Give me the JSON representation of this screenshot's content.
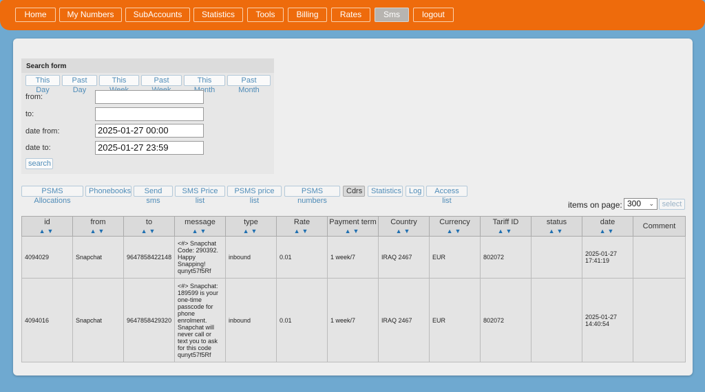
{
  "nav": {
    "items": [
      "Home",
      "My Numbers",
      "SubAccounts",
      "Statistics",
      "Tools",
      "Billing",
      "Rates",
      "Sms",
      "logout"
    ],
    "active": "Sms"
  },
  "search_form": {
    "title": "Search form",
    "ranges": [
      "This Day",
      "Past Day",
      "This Week",
      "Past Week",
      "This Month",
      "Past Month"
    ],
    "from_label": "from:",
    "from_value": "",
    "to_label": "to:",
    "to_value": "",
    "date_from_label": "date from:",
    "date_from_value": "2025-01-27 00:00",
    "date_to_label": "date to:",
    "date_to_value": "2025-01-27 23:59",
    "search_label": "search"
  },
  "subnav": {
    "items": [
      "PSMS Allocations",
      "Phonebooks",
      "Send sms",
      "SMS Price list",
      "PSMS price list",
      "PSMS numbers",
      "Cdrs",
      "Statistics",
      "Log",
      "Access list"
    ],
    "active": "Cdrs"
  },
  "items_on_page": {
    "label": "items on page:",
    "value": "300",
    "button": "select"
  },
  "table": {
    "columns": [
      "id",
      "from",
      "to",
      "message",
      "type",
      "Rate",
      "Payment term",
      "Country",
      "Currency",
      "Tariff ID",
      "status",
      "date",
      "Comment"
    ],
    "sort_arrows": "▲▼",
    "rows": [
      {
        "id": "4094029",
        "from": "Snapchat",
        "to": "9647858422148",
        "message": "<#> Snapchat Code: 290392. Happy Snapping! qunyt57f5Rf",
        "type": "inbound",
        "rate": "0.01",
        "payment_term": "1 week/7",
        "country": "IRAQ 2467",
        "currency": "EUR",
        "tariff_id": "802072",
        "status": "",
        "date": "2025-01-27 17:41:19",
        "comment": ""
      },
      {
        "id": "4094016",
        "from": "Snapchat",
        "to": "9647858429320",
        "message": "<#> Snapchat: 189599 is your one-time passcode for phone enrolment. Snapchat will never call or text you to ask for this code qunyt57f5Rf",
        "type": "inbound",
        "rate": "0.01",
        "payment_term": "1 week/7",
        "country": "IRAQ 2467",
        "currency": "EUR",
        "tariff_id": "802072",
        "status": "",
        "date": "2025-01-27 14:40:54",
        "comment": ""
      }
    ]
  },
  "colors": {
    "topbar": "#ee6b0c",
    "background": "#6fa9d0",
    "panel": "#eeeeee",
    "sort_arrow": "#1f6fb0"
  }
}
